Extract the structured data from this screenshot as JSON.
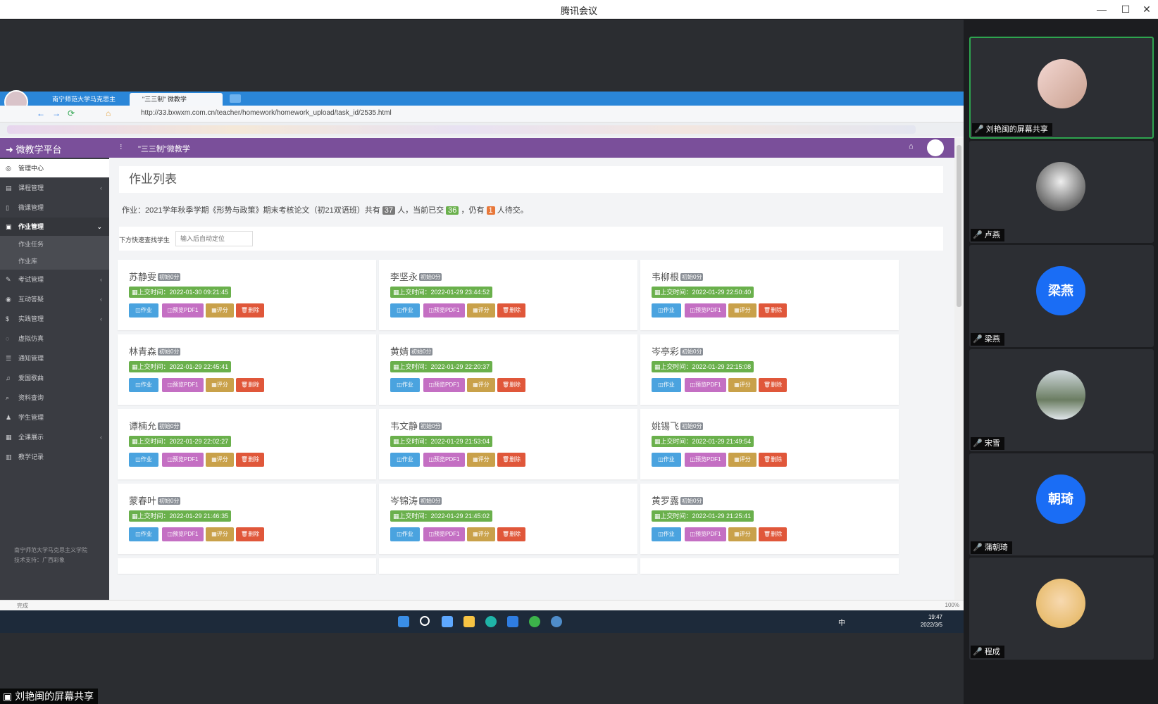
{
  "meeting": {
    "title": "腾讯会议",
    "share_label": "刘艳闽的屏幕共享",
    "controls": {
      "minimize": "—",
      "maximize": "☐",
      "close": "✕"
    }
  },
  "participants": [
    {
      "name": "刘艳闽的屏幕共享",
      "avatar": "photo",
      "active": true
    },
    {
      "name": "卢燕",
      "avatar": "photo"
    },
    {
      "name": "梁燕",
      "avatar_text": "梁燕"
    },
    {
      "name": "宋雪",
      "avatar": "photo"
    },
    {
      "name": "蒲朝琦",
      "avatar_text": "朝琦"
    },
    {
      "name": "程成",
      "avatar": "photo"
    }
  ],
  "browser": {
    "tabs": [
      {
        "label": "南宁师范大学马克思主"
      },
      {
        "label": "\"三三制\" 微教学",
        "active": true
      }
    ],
    "url": "http://33.bxwxm.com.cn/teacher/homework/homework_upload/task_id/2535.html"
  },
  "app": {
    "brand": "微教学平台",
    "breadcrumb": "\"三三制\"微教学",
    "sidebar": {
      "home": "管理中心",
      "items": [
        {
          "label": "课程管理",
          "arrow": "‹"
        },
        {
          "label": "微课管理"
        },
        {
          "label": "作业管理",
          "arrow": "⌄",
          "open": true
        },
        {
          "label": "考试管理",
          "arrow": "‹"
        },
        {
          "label": "互动答疑",
          "arrow": "‹"
        },
        {
          "label": "实践管理",
          "arrow": "‹"
        },
        {
          "label": "虚拟仿真"
        },
        {
          "label": "通知管理"
        },
        {
          "label": "爱国歌曲"
        },
        {
          "label": "资料查询"
        },
        {
          "label": "学生管理"
        },
        {
          "label": "全课展示",
          "arrow": "‹"
        },
        {
          "label": "教学记录"
        }
      ],
      "subitems": [
        "作业任务",
        "作业库"
      ],
      "footer": [
        "南宁师范大学马克思主义学院",
        "技术支持：广西彩象"
      ]
    },
    "page_title": "作业列表",
    "summary": {
      "prefix": "作业：2021学年秋季学期《形势与政策》期末考核论文（初21双语班）共有",
      "total": "37",
      "mid1": "人，当前已交",
      "submitted": "36",
      "mid2": "，仍有",
      "pending": "1",
      "suffix": "人待交。"
    },
    "search": {
      "label": "下方快速查找学生",
      "placeholder": "输入后自动定位"
    },
    "buttons": {
      "homework": "◫作业",
      "pdf": "◫预览PDF1",
      "score": "▦评分",
      "delete": "🗑删除"
    },
    "students": [
      {
        "name": "苏静雯",
        "score": "初始0分",
        "time": "▦上交时间：2022-01-30 09:21:45"
      },
      {
        "name": "李坚永",
        "score": "初始0分",
        "time": "▦上交时间：2022-01-29 23:44:52"
      },
      {
        "name": "韦柳根",
        "score": "初始0分",
        "time": "▦上交时间：2022-01-29 22:50:40"
      },
      {
        "name": "林青森",
        "score": "初始0分",
        "time": "▦上交时间：2022-01-29 22:45:41"
      },
      {
        "name": "黄婧",
        "score": "初始0分",
        "time": "▦上交时间：2022-01-29 22:20:37"
      },
      {
        "name": "岑亭彩",
        "score": "初始0分",
        "time": "▦上交时间：2022-01-29 22:15:08"
      },
      {
        "name": "谭楠允",
        "score": "初始0分",
        "time": "▦上交时间：2022-01-29 22:02:27"
      },
      {
        "name": "韦文静",
        "score": "初始0分",
        "time": "▦上交时间：2022-01-29 21:53:04"
      },
      {
        "name": "姚锡飞",
        "score": "初始0分",
        "time": "▦上交时间：2022-01-29 21:49:54"
      },
      {
        "name": "蒙春叶",
        "score": "初始0分",
        "time": "▦上交时间：2022-01-29 21:46:35"
      },
      {
        "name": "岑锦涛",
        "score": "初始0分",
        "time": "▦上交时间：2022-01-29 21:45:02"
      },
      {
        "name": "黄罗露",
        "score": "初始0分",
        "time": "▦上交时间：2022-01-29 21:25:41"
      }
    ]
  },
  "status_bar": {
    "text": "完成",
    "zoom": "100%"
  },
  "taskbar": {
    "time": "19:47",
    "date": "2022/3/5",
    "ime": "中"
  }
}
